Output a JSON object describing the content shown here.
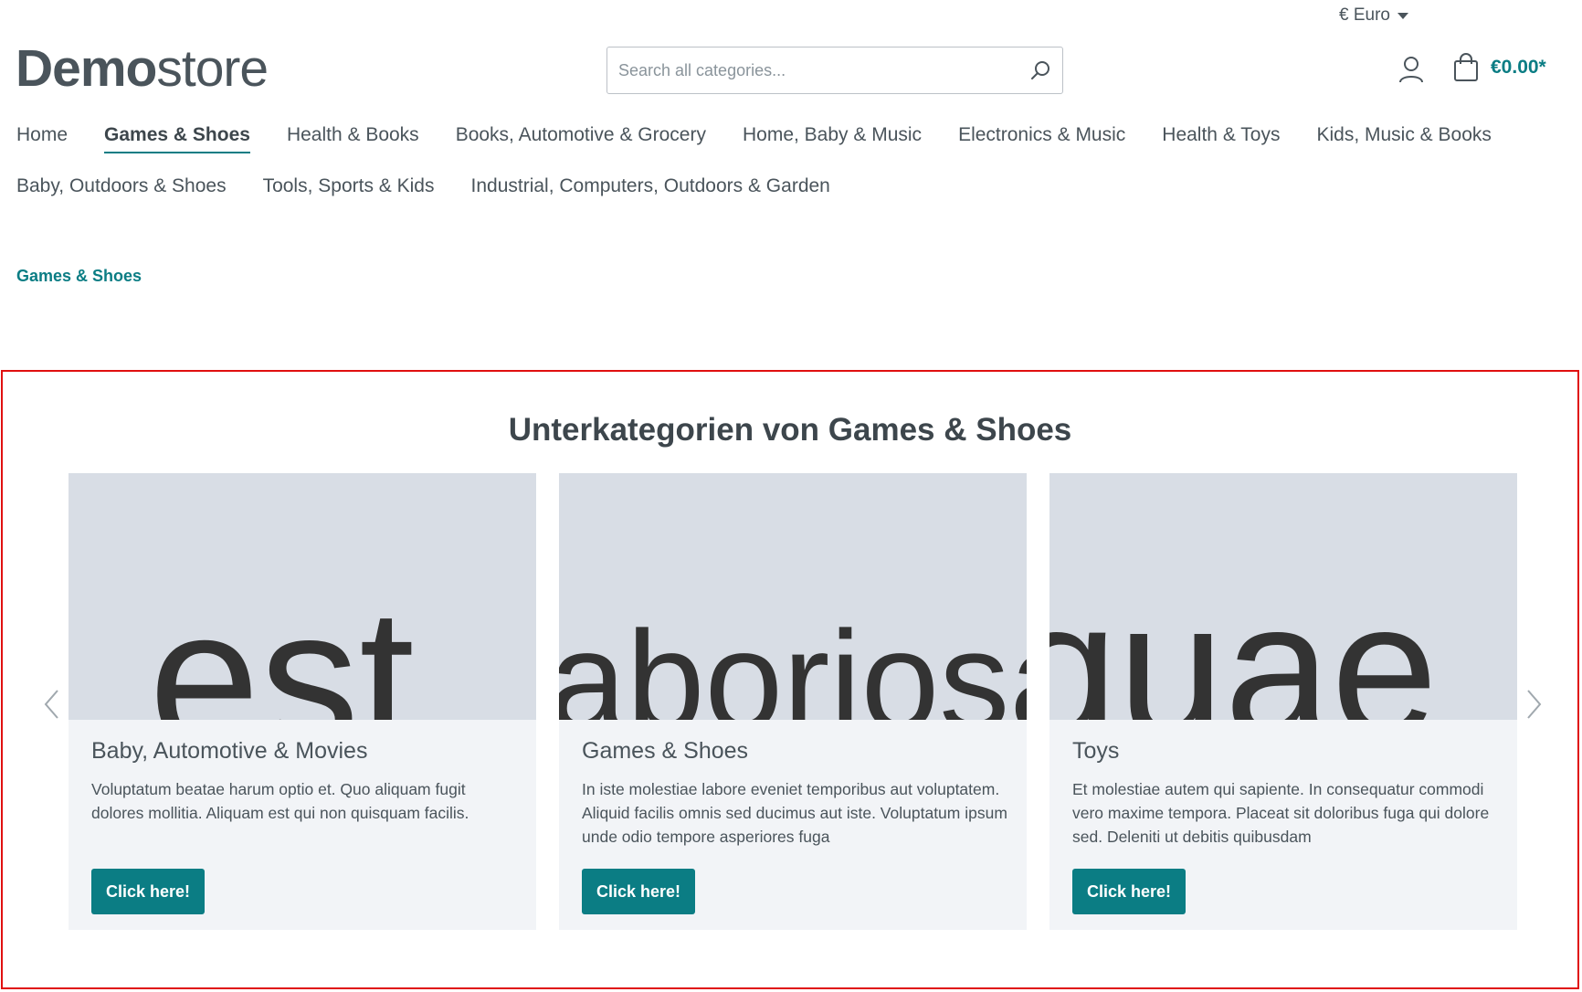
{
  "header": {
    "currency": "€ Euro",
    "logo_bold": "Demo",
    "logo_light": "store",
    "search_placeholder": "Search all categories...",
    "cart_total": "€0.00*"
  },
  "nav": {
    "row1": [
      "Home",
      "Games & Shoes",
      "Health & Books",
      "Books, Automotive & Grocery",
      "Home, Baby & Music",
      "Electronics & Music",
      "Health & Toys",
      "Kids, Music & Books"
    ],
    "row2": [
      "Baby, Outdoors & Shoes",
      "Tools, Sports & Kids",
      "Industrial, Computers, Outdoors & Garden"
    ],
    "active": "Games & Shoes"
  },
  "breadcrumb": "Games & Shoes",
  "section": {
    "title": "Unterkategorien von Games & Shoes",
    "cards": [
      {
        "image_word": "est",
        "title": "Baby, Automotive & Movies",
        "text": "Voluptatum beatae harum optio et. Quo aliquam fugit dolores mollitia. Aliquam est qui non quisquam facilis.",
        "button": "Click here!"
      },
      {
        "image_word": "laboriosam",
        "title": "Games & Shoes",
        "text": "In iste molestiae labore eveniet temporibus aut voluptatem. Aliquid facilis omnis sed ducimus aut iste. Voluptatum ipsum unde odio tempore asperiores fuga",
        "button": "Click here!"
      },
      {
        "image_word": "quae",
        "title": "Toys",
        "text": "Et molestiae autem qui sapiente. In consequatur commodi vero maxime tempora. Placeat sit doloribus fuga qui dolore sed. Deleniti ut debitis quibusdam",
        "button": "Click here!"
      }
    ]
  },
  "colors": {
    "accent": "#0b7d84",
    "text": "#4a545b",
    "card_bg": "#f2f4f7",
    "image_bg": "#d8dde5",
    "highlight_border": "#e01010"
  }
}
